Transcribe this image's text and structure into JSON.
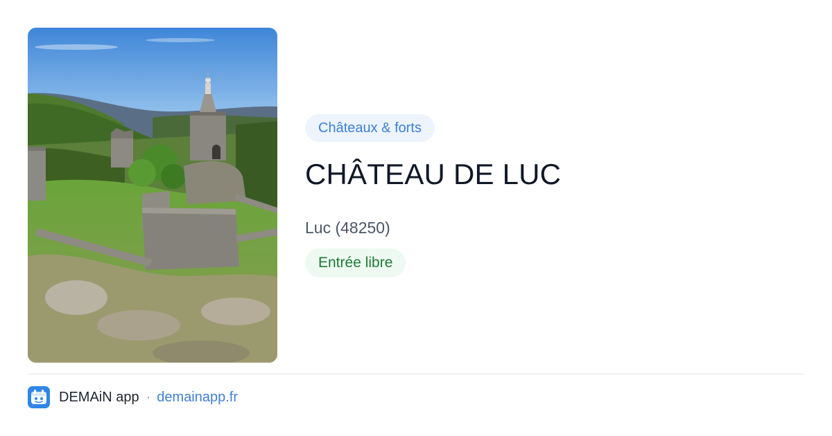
{
  "photo": {
    "alt": "CHÂTEAU DE LUC"
  },
  "place": {
    "category": "Châteaux & forts",
    "title": "CHÂTEAU DE LUC",
    "location": "Luc (48250)",
    "access": "Entrée libre"
  },
  "footer": {
    "app_name": "DEMAiN app",
    "separator": "·",
    "url": "demainapp.fr",
    "app_icon": "demain-app-icon"
  },
  "colors": {
    "category_chip_bg": "#edf4fd",
    "category_chip_text": "#3f7fd4",
    "access_chip_bg": "#eefaf1",
    "access_chip_text": "#1d7a35",
    "title_text": "#101828",
    "link": "#3f7fd4",
    "app_icon_bg": "#2f86e6"
  }
}
